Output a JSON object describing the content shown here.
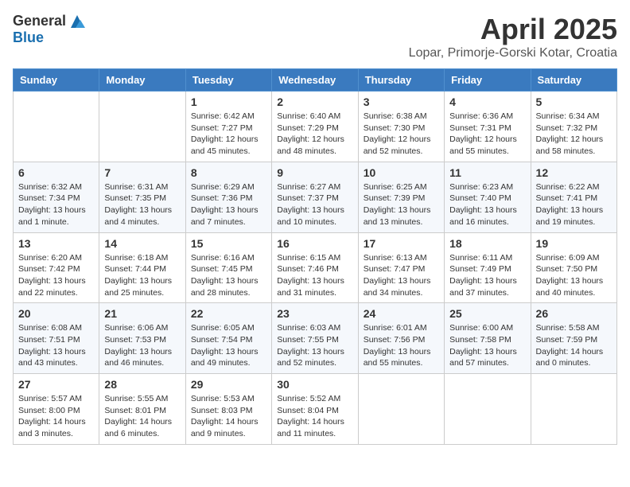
{
  "logo": {
    "general": "General",
    "blue": "Blue"
  },
  "title": "April 2025",
  "subtitle": "Lopar, Primorje-Gorski Kotar, Croatia",
  "days_of_week": [
    "Sunday",
    "Monday",
    "Tuesday",
    "Wednesday",
    "Thursday",
    "Friday",
    "Saturday"
  ],
  "weeks": [
    [
      {
        "day": "",
        "info": ""
      },
      {
        "day": "",
        "info": ""
      },
      {
        "day": "1",
        "info": "Sunrise: 6:42 AM\nSunset: 7:27 PM\nDaylight: 12 hours\nand 45 minutes."
      },
      {
        "day": "2",
        "info": "Sunrise: 6:40 AM\nSunset: 7:29 PM\nDaylight: 12 hours\nand 48 minutes."
      },
      {
        "day": "3",
        "info": "Sunrise: 6:38 AM\nSunset: 7:30 PM\nDaylight: 12 hours\nand 52 minutes."
      },
      {
        "day": "4",
        "info": "Sunrise: 6:36 AM\nSunset: 7:31 PM\nDaylight: 12 hours\nand 55 minutes."
      },
      {
        "day": "5",
        "info": "Sunrise: 6:34 AM\nSunset: 7:32 PM\nDaylight: 12 hours\nand 58 minutes."
      }
    ],
    [
      {
        "day": "6",
        "info": "Sunrise: 6:32 AM\nSunset: 7:34 PM\nDaylight: 13 hours\nand 1 minute."
      },
      {
        "day": "7",
        "info": "Sunrise: 6:31 AM\nSunset: 7:35 PM\nDaylight: 13 hours\nand 4 minutes."
      },
      {
        "day": "8",
        "info": "Sunrise: 6:29 AM\nSunset: 7:36 PM\nDaylight: 13 hours\nand 7 minutes."
      },
      {
        "day": "9",
        "info": "Sunrise: 6:27 AM\nSunset: 7:37 PM\nDaylight: 13 hours\nand 10 minutes."
      },
      {
        "day": "10",
        "info": "Sunrise: 6:25 AM\nSunset: 7:39 PM\nDaylight: 13 hours\nand 13 minutes."
      },
      {
        "day": "11",
        "info": "Sunrise: 6:23 AM\nSunset: 7:40 PM\nDaylight: 13 hours\nand 16 minutes."
      },
      {
        "day": "12",
        "info": "Sunrise: 6:22 AM\nSunset: 7:41 PM\nDaylight: 13 hours\nand 19 minutes."
      }
    ],
    [
      {
        "day": "13",
        "info": "Sunrise: 6:20 AM\nSunset: 7:42 PM\nDaylight: 13 hours\nand 22 minutes."
      },
      {
        "day": "14",
        "info": "Sunrise: 6:18 AM\nSunset: 7:44 PM\nDaylight: 13 hours\nand 25 minutes."
      },
      {
        "day": "15",
        "info": "Sunrise: 6:16 AM\nSunset: 7:45 PM\nDaylight: 13 hours\nand 28 minutes."
      },
      {
        "day": "16",
        "info": "Sunrise: 6:15 AM\nSunset: 7:46 PM\nDaylight: 13 hours\nand 31 minutes."
      },
      {
        "day": "17",
        "info": "Sunrise: 6:13 AM\nSunset: 7:47 PM\nDaylight: 13 hours\nand 34 minutes."
      },
      {
        "day": "18",
        "info": "Sunrise: 6:11 AM\nSunset: 7:49 PM\nDaylight: 13 hours\nand 37 minutes."
      },
      {
        "day": "19",
        "info": "Sunrise: 6:09 AM\nSunset: 7:50 PM\nDaylight: 13 hours\nand 40 minutes."
      }
    ],
    [
      {
        "day": "20",
        "info": "Sunrise: 6:08 AM\nSunset: 7:51 PM\nDaylight: 13 hours\nand 43 minutes."
      },
      {
        "day": "21",
        "info": "Sunrise: 6:06 AM\nSunset: 7:53 PM\nDaylight: 13 hours\nand 46 minutes."
      },
      {
        "day": "22",
        "info": "Sunrise: 6:05 AM\nSunset: 7:54 PM\nDaylight: 13 hours\nand 49 minutes."
      },
      {
        "day": "23",
        "info": "Sunrise: 6:03 AM\nSunset: 7:55 PM\nDaylight: 13 hours\nand 52 minutes."
      },
      {
        "day": "24",
        "info": "Sunrise: 6:01 AM\nSunset: 7:56 PM\nDaylight: 13 hours\nand 55 minutes."
      },
      {
        "day": "25",
        "info": "Sunrise: 6:00 AM\nSunset: 7:58 PM\nDaylight: 13 hours\nand 57 minutes."
      },
      {
        "day": "26",
        "info": "Sunrise: 5:58 AM\nSunset: 7:59 PM\nDaylight: 14 hours\nand 0 minutes."
      }
    ],
    [
      {
        "day": "27",
        "info": "Sunrise: 5:57 AM\nSunset: 8:00 PM\nDaylight: 14 hours\nand 3 minutes."
      },
      {
        "day": "28",
        "info": "Sunrise: 5:55 AM\nSunset: 8:01 PM\nDaylight: 14 hours\nand 6 minutes."
      },
      {
        "day": "29",
        "info": "Sunrise: 5:53 AM\nSunset: 8:03 PM\nDaylight: 14 hours\nand 9 minutes."
      },
      {
        "day": "30",
        "info": "Sunrise: 5:52 AM\nSunset: 8:04 PM\nDaylight: 14 hours\nand 11 minutes."
      },
      {
        "day": "",
        "info": ""
      },
      {
        "day": "",
        "info": ""
      },
      {
        "day": "",
        "info": ""
      }
    ]
  ]
}
